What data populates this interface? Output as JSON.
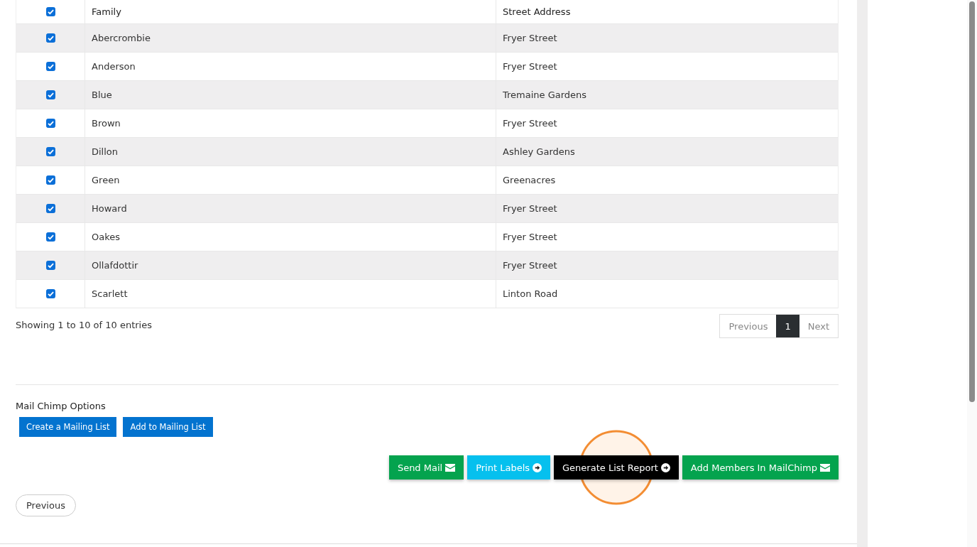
{
  "table": {
    "header": {
      "checked": true,
      "columns": [
        "Family",
        "Street Address"
      ]
    },
    "rows": [
      {
        "checked": true,
        "family": "Abercrombie",
        "street": "Fryer Street"
      },
      {
        "checked": true,
        "family": "Anderson",
        "street": "Fryer Street"
      },
      {
        "checked": true,
        "family": "Blue",
        "street": "Tremaine Gardens"
      },
      {
        "checked": true,
        "family": "Brown",
        "street": "Fryer Street"
      },
      {
        "checked": true,
        "family": "Dillon",
        "street": "Ashley Gardens"
      },
      {
        "checked": true,
        "family": "Green",
        "street": "Greenacres"
      },
      {
        "checked": true,
        "family": "Howard",
        "street": "Fryer Street"
      },
      {
        "checked": true,
        "family": "Oakes",
        "street": "Fryer Street"
      },
      {
        "checked": true,
        "family": "Ollafdottir",
        "street": "Fryer Street"
      },
      {
        "checked": true,
        "family": "Scarlett",
        "street": "Linton Road"
      }
    ]
  },
  "info": "Showing 1 to 10 of 10 entries",
  "pagination": {
    "previous": "Previous",
    "pages": [
      {
        "label": "1",
        "selected": true
      }
    ],
    "next": "Next"
  },
  "mailchimp": {
    "title": "Mail Chimp Options",
    "buttons": [
      "Create a Mailing List",
      "Add to Mailing List"
    ]
  },
  "actions": [
    {
      "label": "Send Mail",
      "kind": "mail",
      "highlighted": false
    },
    {
      "label": "Print Labels",
      "kind": "print",
      "highlighted": false
    },
    {
      "label": "Generate List Report",
      "kind": "report",
      "highlighted": true
    },
    {
      "label": "Add Members In MailChimp",
      "kind": "mail",
      "highlighted": false
    }
  ],
  "back_button": "Previous"
}
